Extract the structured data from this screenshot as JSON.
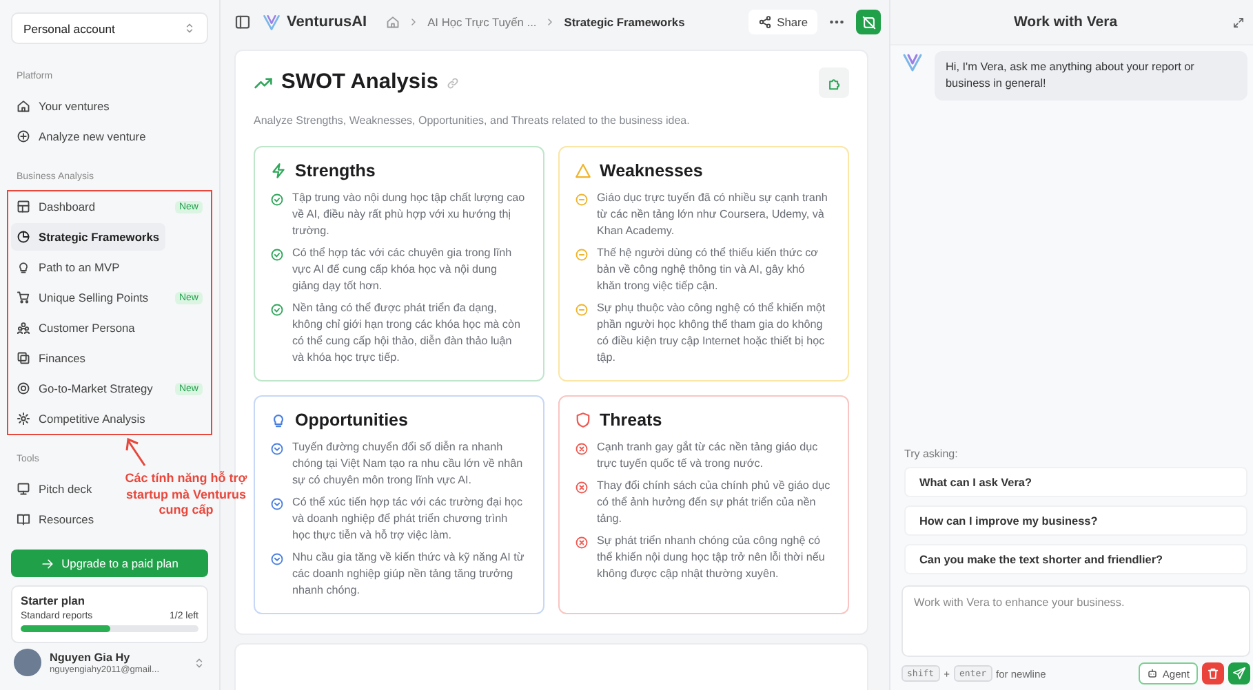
{
  "sidebar": {
    "account": "Personal account",
    "sections": [
      {
        "heading": "Platform",
        "highlighted": false,
        "items": [
          {
            "label": "Your ventures",
            "selected": false
          },
          {
            "label": "Analyze new venture",
            "selected": false
          }
        ]
      },
      {
        "heading": "Business Analysis",
        "highlighted": true,
        "items": [
          {
            "label": "Dashboard",
            "selected": false,
            "badge": "New"
          },
          {
            "label": "Strategic Frameworks",
            "selected": true
          },
          {
            "label": "Path to an MVP",
            "selected": false
          },
          {
            "label": "Unique Selling Points",
            "selected": false,
            "badge": "New"
          },
          {
            "label": "Customer Persona",
            "selected": false
          },
          {
            "label": "Finances",
            "selected": false
          },
          {
            "label": "Go-to-Market Strategy",
            "selected": false,
            "badge": "New"
          },
          {
            "label": "Competitive Analysis",
            "selected": false
          }
        ]
      },
      {
        "heading": "Tools",
        "highlighted": false,
        "items": [
          {
            "label": "Pitch deck",
            "selected": false
          },
          {
            "label": "Resources",
            "selected": false
          }
        ]
      }
    ],
    "upgrade_button": "Upgrade to a paid plan",
    "plan": {
      "title": "Starter plan",
      "label": "Standard reports",
      "remaining": "1/2 left",
      "level": 0.5
    },
    "user": {
      "name": "Nguyen Gia Hy",
      "email": "nguyengiahy2011@gmail..."
    }
  },
  "annotation": {
    "text": "Các tính năng hỗ trợ startup mà Venturus cung cấp"
  },
  "topbar": {
    "brand": "VenturusAI",
    "breadcrumb": [
      "AI Học Trực Tuyến ...",
      "Strategic Frameworks"
    ],
    "share": "Share"
  },
  "swot": {
    "title": "SWOT Analysis",
    "description": "Analyze Strengths, Weaknesses, Opportunities, and Threats related to the business idea.",
    "quadrants": [
      {
        "kind": "strengths",
        "title": "Strengths",
        "points": [
          "Tập trung vào nội dung học tập chất lượng cao về AI, điều này rất phù hợp với xu hướng thị trường.",
          "Có thể hợp tác với các chuyên gia trong lĩnh vực AI để cung cấp khóa học và nội dung giảng dạy tốt hơn.",
          "Nền tảng có thể được phát triển đa dạng, không chỉ giới hạn trong các khóa học mà còn có thể cung cấp hội thảo, diễn đàn thảo luận và khóa học trực tiếp."
        ]
      },
      {
        "kind": "weaknesses",
        "title": "Weaknesses",
        "points": [
          "Giáo dục trực tuyến đã có nhiều sự cạnh tranh từ các nền tảng lớn như Coursera, Udemy, và Khan Academy.",
          "Thế hệ người dùng có thể thiếu kiến thức cơ bản về công nghệ thông tin và AI, gây khó khăn trong việc tiếp cận.",
          "Sự phụ thuộc vào công nghệ có thể khiến một phần người học không thể tham gia do không có điều kiện truy cập Internet hoặc thiết bị học tập."
        ]
      },
      {
        "kind": "opportunities",
        "title": "Opportunities",
        "points": [
          "Tuyến đường chuyển đổi số diễn ra nhanh chóng tại Việt Nam tạo ra nhu cầu lớn về nhân sự có chuyên môn trong lĩnh vực AI.",
          "Có thể xúc tiến hợp tác với các trường đại học và doanh nghiệp để phát triển chương trình học thực tiễn và hỗ trợ việc làm.",
          "Nhu cầu gia tăng về kiến thức và kỹ năng AI từ các doanh nghiệp giúp nền tảng tăng trưởng nhanh chóng."
        ]
      },
      {
        "kind": "threats",
        "title": "Threats",
        "points": [
          "Cạnh tranh gay gắt từ các nền tảng giáo dục trực tuyến quốc tế và trong nước.",
          "Thay đổi chính sách của chính phủ về giáo dục có thể ảnh hưởng đến sự phát triển của nền tảng.",
          "Sự phát triển nhanh chóng của công nghệ có thể khiến nội dung học tập trở nên lỗi thời nếu không được cập nhật thường xuyên."
        ]
      }
    ]
  },
  "chat": {
    "title": "Work with Vera",
    "messages": [
      {
        "text": "Hi, I'm Vera, ask me anything about your report or business in general!"
      }
    ],
    "try_label": "Try asking:",
    "suggestions": [
      "What can I ask Vera?",
      "How can I improve my business?",
      "Can you make the text shorter and friendlier?"
    ],
    "input": {
      "placeholder": "Work with Vera to enhance your business."
    },
    "hint": {
      "keys": [
        "shift",
        "enter"
      ],
      "joiner": "+",
      "text": "for newline"
    },
    "agent_button": "Agent"
  }
}
